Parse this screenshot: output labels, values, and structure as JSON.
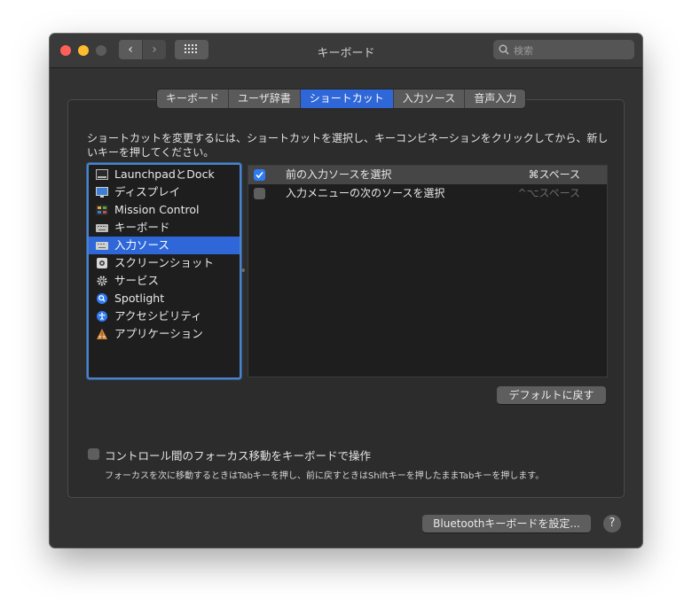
{
  "window": {
    "title": "キーボード",
    "search_placeholder": "検索",
    "nav_back": "‹",
    "nav_forward": "›"
  },
  "tabs": [
    {
      "label": "キーボード"
    },
    {
      "label": "ユーザ辞書"
    },
    {
      "label": "ショートカット",
      "active": true
    },
    {
      "label": "入力ソース"
    },
    {
      "label": "音声入力"
    }
  ],
  "instructions": "ショートカットを変更するには、ショートカットを選択し、キーコンビネーションをクリックしてから、新しいキーを押してください。",
  "categories": [
    {
      "label": "LaunchpadとDock",
      "icon": "launchpad-icon"
    },
    {
      "label": "ディスプレイ",
      "icon": "display-icon"
    },
    {
      "label": "Mission Control",
      "icon": "mission-control-icon"
    },
    {
      "label": "キーボード",
      "icon": "keyboard-icon"
    },
    {
      "label": "入力ソース",
      "icon": "input-source-icon",
      "selected": true
    },
    {
      "label": "スクリーンショット",
      "icon": "screenshot-icon"
    },
    {
      "label": "サービス",
      "icon": "gear-icon"
    },
    {
      "label": "Spotlight",
      "icon": "spotlight-icon"
    },
    {
      "label": "アクセシビリティ",
      "icon": "accessibility-icon"
    },
    {
      "label": "アプリケーション",
      "icon": "applications-icon"
    }
  ],
  "shortcuts": [
    {
      "name": "前の入力ソースを選択",
      "key": "⌘スペース",
      "checked": true
    },
    {
      "name": "入力メニューの次のソースを選択",
      "key": "^⌥スペース",
      "checked": false
    }
  ],
  "defaults_button": "デフォルトに戻す",
  "focus": {
    "label": "コントロール間のフォーカス移動をキーボードで操作",
    "note": "フォーカスを次に移動するときはTabキーを押し、前に戻すときはShiftキーを押したままTabキーを押します。",
    "checked": false
  },
  "bluetooth_button": "Bluetoothキーボードを設定...",
  "help": "?",
  "colors": {
    "accent": "#2f67d8",
    "checkbox_on": "#2f7bf5",
    "window_bg": "#323232"
  }
}
